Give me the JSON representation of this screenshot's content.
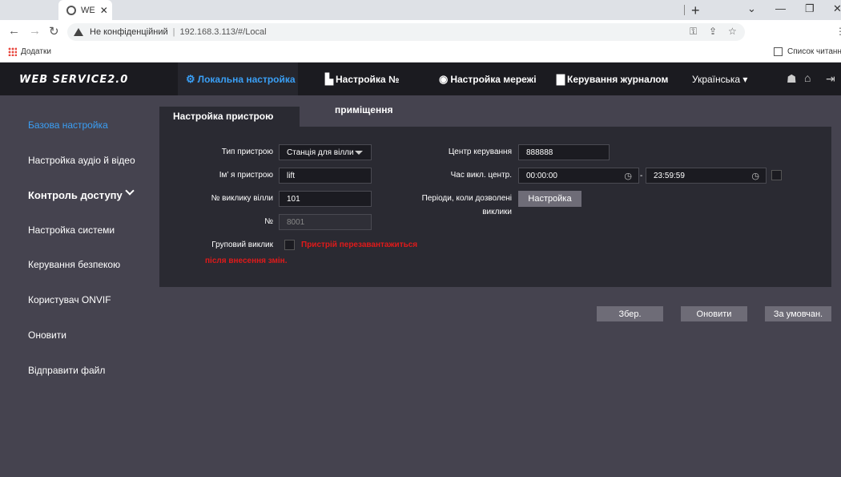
{
  "browser": {
    "tab_title": "WE",
    "security_label": "Не конфіденційний",
    "url": "192.168.3.113/#/Local",
    "bookmarks_apps": "Додатки",
    "reading_list": "Список читанн"
  },
  "header": {
    "logo": "WEB SERVICE2.0",
    "nav": [
      {
        "label": "Локальна настройка",
        "icon": "gear-icon"
      },
      {
        "label": "Настройка №",
        "icon": "building-icon"
      },
      {
        "label": "Настройка мережі",
        "icon": "globe-icon"
      },
      {
        "label": "Керування журналом",
        "icon": "log-icon"
      }
    ],
    "language": "Українська",
    "accent": "#3a9ff5"
  },
  "sidebar": {
    "items": [
      {
        "label": "Базова настройка"
      },
      {
        "label": "Настройка аудіо й відео"
      },
      {
        "label": "Контроль доступу"
      },
      {
        "label": "Настройка системи"
      },
      {
        "label": "Керування безпекою"
      },
      {
        "label": "Користувач ONVIF"
      },
      {
        "label": "Оновити"
      },
      {
        "label": "Відправити файл"
      }
    ]
  },
  "content": {
    "tab_active": "Настройка пристрою",
    "tab_second": "приміщення",
    "form": {
      "device_type_label": "Тип пристрою",
      "device_type_value": "Станція для вілли",
      "device_name_label": "Ім’ я пристрою",
      "device_name_value": "lift",
      "villa_call_label": "№ виклику вілли",
      "villa_call_value": "101",
      "no_label": "№",
      "no_value": "8001",
      "group_call_label": "Груповий виклик",
      "warning": "Пристрій перезавантажиться",
      "warning_2": "після внесення змін.",
      "center_label": "Центр керування",
      "center_value": "888888",
      "call_time_label": "Час викл. центр.",
      "time_start": "00:00:00",
      "time_sep": "-",
      "time_end": "23:59:59",
      "periods_label": "Періоди, коли дозволені",
      "periods_label_2": "виклики",
      "periods_button": "Настройка"
    },
    "buttons": {
      "save": "Збер.",
      "refresh": "Оновити",
      "default": "За умовчан."
    }
  }
}
